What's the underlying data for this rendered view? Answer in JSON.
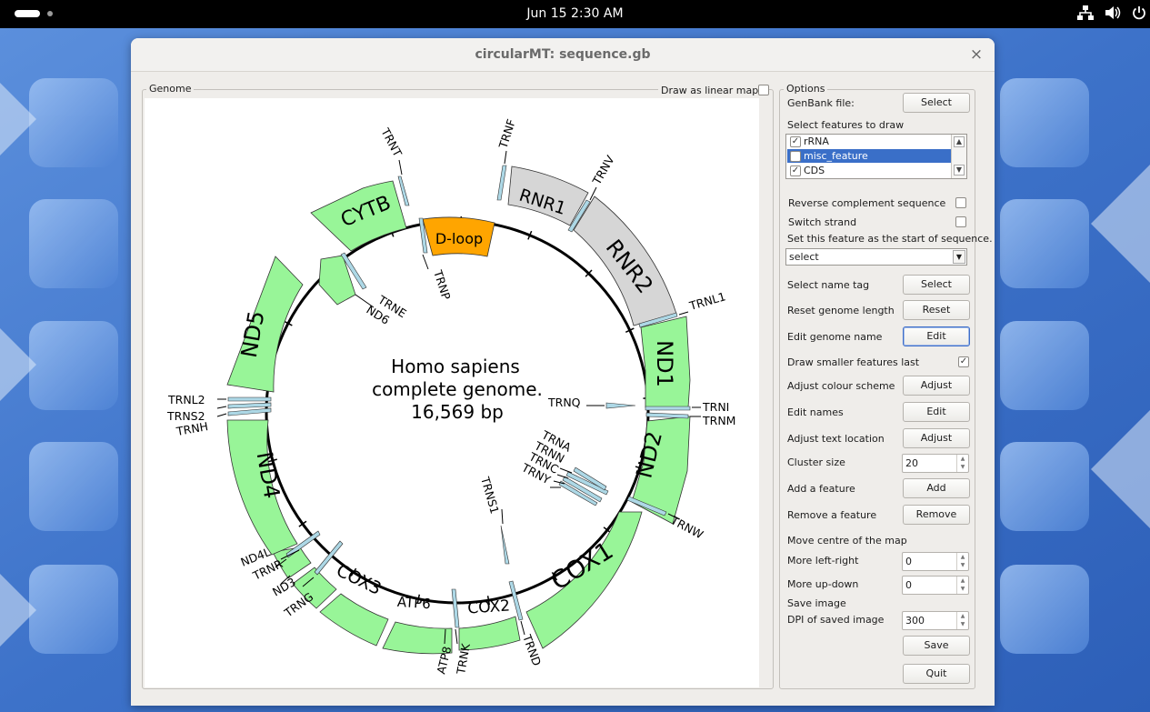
{
  "topbar": {
    "clock": "Jun 15   2:30 AM",
    "icons": [
      "network-icon",
      "volume-icon",
      "power-icon"
    ]
  },
  "window": {
    "title": "circularMT: sequence.gb",
    "close_glyph": "×"
  },
  "genome_panel": {
    "group_title": "Genome",
    "linear_map_label": "Draw as linear map",
    "linear_map_checked": false
  },
  "map": {
    "title_lines": [
      "Homo sapiens",
      "complete genome.",
      "16,569 bp"
    ],
    "colors": {
      "CDS": "#98f598",
      "rRNA": "#d6d6d6",
      "misc_feature": "#ffa500",
      "tRNA": "#add8e6"
    },
    "feature_labels": {
      "cytb": "CYTB",
      "rnr1": "RNR1",
      "rnr2": "RNR2",
      "dloop": "D-loop",
      "nd1": "ND1",
      "nd2": "ND2",
      "cox1": "COX1",
      "cox2": "COX2",
      "atp6": "ATP6",
      "cox3": "COX3",
      "nd4": "ND4",
      "nd5": "ND5",
      "nd6": "ND6",
      "nd4l": "ND4L",
      "nd3": "ND3",
      "atp8": "ATP8"
    },
    "trna_labels": {
      "trnt": "TRNT",
      "trnf": "TRNF",
      "trnv": "TRNV",
      "trnl1": "TRNL1",
      "trni": "TRNI",
      "trnm": "TRNM",
      "trnq": "TRNQ",
      "trna": "TRNA",
      "trnn": "TRNN",
      "trnc": "TRNC",
      "trny": "TRNY",
      "trnw": "TRNW",
      "trns1": "TRNS1",
      "trnd": "TRND",
      "trnk": "TRNK",
      "trng": "TRNG",
      "trnr": "TRNR",
      "trnh": "TRNH",
      "trns2": "TRNS2",
      "trnl2": "TRNL2",
      "trne": "TRNE",
      "trnp": "TRNP"
    }
  },
  "options": {
    "group_title": "Options",
    "genbank_label": "GenBank file:",
    "genbank_button": "Select",
    "features_label": "Select features to draw",
    "features": [
      {
        "name": "rRNA",
        "checked": true,
        "check_glyph": "✓"
      },
      {
        "name": "misc_feature",
        "checked": false,
        "check_glyph": ""
      },
      {
        "name": "CDS",
        "checked": true,
        "check_glyph": "✓"
      }
    ],
    "reverse_label": "Reverse complement sequence",
    "switch_label": "Switch strand",
    "start_label": "Set this feature as the start of sequence.",
    "start_value": "select",
    "name_tag_label": "Select name tag",
    "name_tag_button": "Select",
    "reset_label": "Reset genome length",
    "reset_button": "Reset",
    "edit_genome_label": "Edit genome name",
    "edit_genome_button": "Edit",
    "smaller_last_label": "Draw smaller features last",
    "smaller_last_glyph": "✓",
    "colour_label": "Adjust colour scheme",
    "colour_button": "Adjust",
    "names_label": "Edit names",
    "names_button": "Edit",
    "text_loc_label": "Adjust text location",
    "text_loc_button": "Adjust",
    "cluster_label": "Cluster size",
    "cluster_value": "20",
    "add_label": "Add a feature",
    "add_button": "Add",
    "remove_label": "Remove a feature",
    "remove_button": "Remove",
    "move_label": "Move centre of the map",
    "left_right_label": "More left-right",
    "left_right_value": "0",
    "up_down_label": "More up-down",
    "up_down_value": "0",
    "save_image_label": "Save image",
    "dpi_label": "DPI of saved image",
    "dpi_value": "300",
    "save_button": "Save",
    "quit_button": "Quit"
  }
}
